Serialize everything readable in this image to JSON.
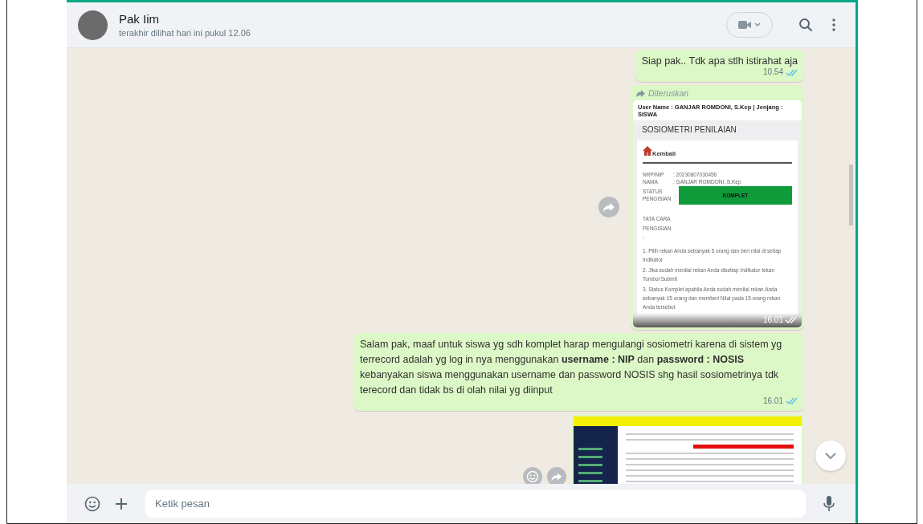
{
  "header": {
    "contact_name": "Pak Iim",
    "last_seen": "terakhir dilihat hari ini pukul 12.06"
  },
  "messages": [
    {
      "kind": "text",
      "text": "Siap pak.. Tdk apa stlh istirahat aja",
      "time": "10.54",
      "read": true
    },
    {
      "kind": "forwarded_image",
      "forwarded_label": "Diteruskan",
      "time": "16.01",
      "read": true,
      "screenshot": {
        "user_name": "User Name : GANJAR ROMDONI, S.Kep | Jenjang : SISWA",
        "title": "SOSIOMETRI PENILAIAN",
        "back_label": "Kembali",
        "fields": [
          {
            "label": "NRP/NIP",
            "value": ": 20230807030456"
          },
          {
            "label": "NAMA",
            "value": ": GANJAR ROMDONI, S.Kep"
          }
        ],
        "status_label": "STATUS PENGISIAN",
        "status_colon": ":",
        "status_value": "KOMPLET",
        "procedure_label": "TATA CARA PENGISIAN",
        "procedure_colon": ":",
        "steps": [
          "1. Pilih rekan Anda sebanyak 5 orang dan beri nilai di setiap Indikator",
          "2. Jika sudah menilai rekan Anda disetiap Indikator tekan Tombol Submit",
          "3. Status Komplet apabila Anda sudah menilai rekan Anda sebanyak 15 orang dan memberi Nilai pada 15 orang rekan Anda tersebut"
        ]
      }
    },
    {
      "kind": "text",
      "text": "Salam pak, maaf untuk siswa yg sdh komplet harap mengulangi sosiometri karena di sistem yg terrecord adalah yg log in nya menggunakan **username : NIP** dan **password : NOSIS** kebanyakan siswa menggunakan username dan password NOSIS shg hasil sosiometrinya tdk terecord dan tidak bs di olah nilai yg diinput",
      "time": "16.01",
      "read": true
    },
    {
      "kind": "image"
    }
  ],
  "composer": {
    "placeholder": "Ketik pesan"
  }
}
